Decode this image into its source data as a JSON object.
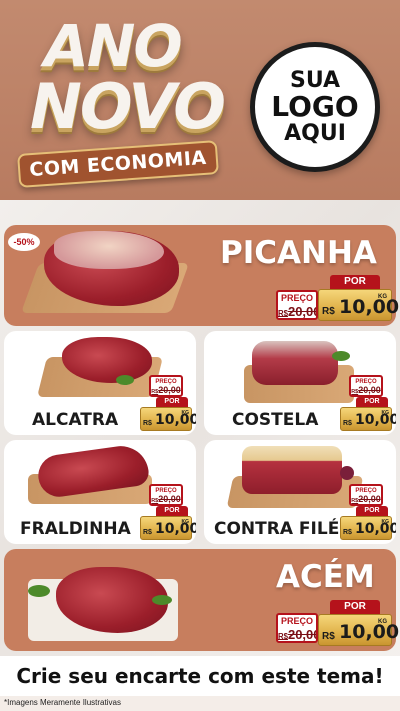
{
  "header": {
    "title_line1": "ANO",
    "title_line2": "NOVO",
    "banner": "COM ECONOMIA",
    "logo_line1": "SUA",
    "logo_line2": "LOGO",
    "logo_line3": "AQUI"
  },
  "discount_badge": "-50%",
  "products": [
    {
      "name": "PICANHA",
      "preco_label": "PREÇO",
      "old_currency": "R$",
      "old_price": "20,00",
      "por_label": "POR",
      "currency": "R$",
      "price": "10,00",
      "unit": "KG"
    },
    {
      "name": "ALCATRA",
      "preco_label": "PREÇO",
      "old_currency": "R$",
      "old_price": "20,00",
      "por_label": "POR",
      "currency": "R$",
      "price": "10,00",
      "unit": "KG"
    },
    {
      "name": "COSTELA",
      "preco_label": "PREÇO",
      "old_currency": "R$",
      "old_price": "20,00",
      "por_label": "POR",
      "currency": "R$",
      "price": "10,00",
      "unit": "KG"
    },
    {
      "name": "FRALDINHA",
      "preco_label": "PREÇO",
      "old_currency": "R$",
      "old_price": "20,00",
      "por_label": "POR",
      "currency": "R$",
      "price": "10,00",
      "unit": "KG"
    },
    {
      "name": "CONTRA FILÉ",
      "preco_label": "PREÇO",
      "old_currency": "R$",
      "old_price": "20,00",
      "por_label": "POR",
      "currency": "R$",
      "price": "10,00",
      "unit": "KG"
    },
    {
      "name": "ACÉM",
      "preco_label": "PREÇO",
      "old_currency": "R$",
      "old_price": "20,00",
      "por_label": "POR",
      "currency": "R$",
      "price": "10,00",
      "unit": "KG"
    }
  ],
  "footer": {
    "cta": "Crie seu encarte com este tema!",
    "disclaimer": "*Imagens Meramente Ilustrativas"
  },
  "colors": {
    "background": "#c08d73",
    "orange_card": "#c77e5e",
    "price_red": "#b5121b",
    "price_gold": "#e0b24a"
  }
}
